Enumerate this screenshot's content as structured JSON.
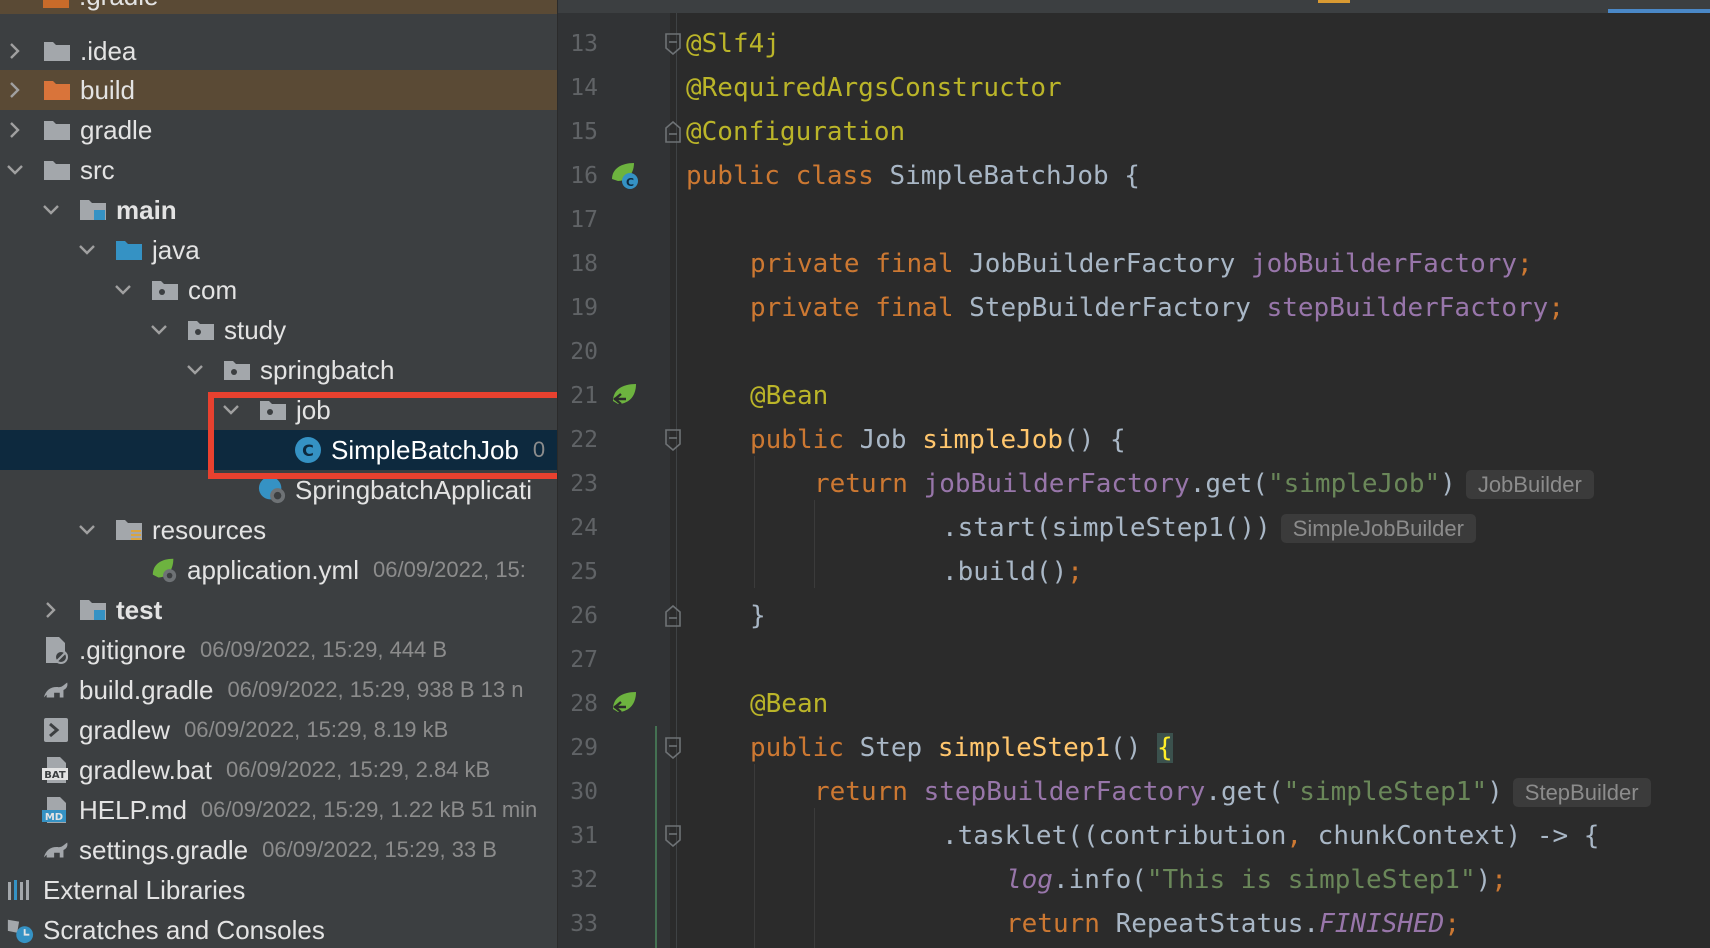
{
  "project_tree": {
    "top_partial": ".gradle",
    "rows": [
      {
        "label": ".idea",
        "meta": "",
        "icon": "folder-icon"
      },
      {
        "label": "build",
        "meta": "",
        "icon": "folder-orange-icon"
      },
      {
        "label": "gradle",
        "meta": "",
        "icon": "folder-icon"
      },
      {
        "label": "src",
        "meta": "",
        "icon": "folder-icon"
      },
      {
        "label": "main",
        "meta": "",
        "icon": "source-root-folder-icon"
      },
      {
        "label": "java",
        "meta": "",
        "icon": "java-source-folder-icon"
      },
      {
        "label": "com",
        "meta": "",
        "icon": "package-icon"
      },
      {
        "label": "study",
        "meta": "",
        "icon": "package-icon"
      },
      {
        "label": "springbatch",
        "meta": "",
        "icon": "package-icon"
      },
      {
        "label": "job",
        "meta": "",
        "icon": "package-icon"
      },
      {
        "label": "SimpleBatchJob",
        "meta": "0",
        "icon": "java-class-icon"
      },
      {
        "label": "SpringbatchApplicati",
        "meta": "",
        "icon": "spring-boot-class-icon"
      },
      {
        "label": "resources",
        "meta": "",
        "icon": "resources-folder-icon"
      },
      {
        "label": "application.yml",
        "meta": "06/09/2022, 15:",
        "icon": "spring-yml-icon"
      },
      {
        "label": "test",
        "meta": "",
        "icon": "test-folder-icon"
      },
      {
        "label": ".gitignore",
        "meta": "06/09/2022, 15:29, 444 B",
        "icon": "gitignore-file-icon"
      },
      {
        "label": "build.gradle",
        "meta": "06/09/2022, 15:29, 938 B 13 n",
        "icon": "gradle-file-icon"
      },
      {
        "label": "gradlew",
        "meta": "06/09/2022, 15:29, 8.19 kB",
        "icon": "shell-script-icon"
      },
      {
        "label": "gradlew.bat",
        "meta": "06/09/2022, 15:29, 2.84 kB",
        "icon": "bat-file-icon"
      },
      {
        "label": "HELP.md",
        "meta": "06/09/2022, 15:29, 1.22 kB 51 min",
        "icon": "markdown-file-icon"
      },
      {
        "label": "settings.gradle",
        "meta": "06/09/2022, 15:29, 33 B",
        "icon": "gradle-file-icon"
      },
      {
        "label": "External Libraries",
        "meta": "",
        "icon": "libraries-icon"
      },
      {
        "label": "Scratches and Consoles",
        "meta": "",
        "icon": "scratches-icon"
      }
    ]
  },
  "editor": {
    "line_numbers": [
      "13",
      "14",
      "15",
      "16",
      "17",
      "18",
      "19",
      "20",
      "21",
      "22",
      "23",
      "24",
      "25",
      "26",
      "27",
      "28",
      "29",
      "30",
      "31",
      "32",
      "33"
    ],
    "lines": {
      "l13": {
        "ann": "@Slf4j"
      },
      "l14": {
        "ann": "@RequiredArgsConstructor"
      },
      "l15": {
        "ann": "@Configuration"
      },
      "l16": {
        "kw": "public class ",
        "name": "SimpleBatchJob",
        "rest": " {"
      },
      "l18": {
        "kw": "private final ",
        "type": "JobBuilderFactory ",
        "field": "jobBuilderFactory",
        "punc": ";"
      },
      "l19": {
        "kw": "private final ",
        "type": "StepBuilderFactory ",
        "field": "stepBuilderFactory",
        "punc": ";"
      },
      "l21": {
        "ann": "@Bean"
      },
      "l22": {
        "kw": "public ",
        "type": "Job ",
        "fn": "simpleJob",
        "rest": "() {"
      },
      "l23": {
        "kw": "return ",
        "field": "jobBuilderFactory",
        "rest": ".get(",
        "str": "\"simpleJob\"",
        "close": ")",
        "hint": "JobBuilder"
      },
      "l24": {
        "rest": ".start(simpleStep1())",
        "hint": "SimpleJobBuilder"
      },
      "l25": {
        "rest": ".build()",
        "punc": ";"
      },
      "l26": {
        "rest": "}"
      },
      "l28": {
        "ann": "@Bean"
      },
      "l29": {
        "kw": "public ",
        "type": "Step ",
        "fn": "simpleStep1",
        "rest": "() ",
        "brace": "{"
      },
      "l30": {
        "kw": "return ",
        "field": "stepBuilderFactory",
        "rest": ".get(",
        "str": "\"simpleStep1\"",
        "close": ")",
        "hint": "StepBuilder"
      },
      "l31": {
        "rest": ".tasklet((contribution",
        "punc": ",",
        "rest2": " chunkContext) -> {"
      },
      "l32": {
        "log": "log",
        "rest": ".info(",
        "str": "\"This is simpleStep1\"",
        "close": ")",
        "punc": ";"
      },
      "l33": {
        "kw": "return ",
        "type": "RepeatStatus.",
        "const": "FINISHED",
        "punc": ";"
      }
    }
  },
  "colors": {
    "tree_bg": "#3c3f41",
    "editor_bg": "#2b2b2b",
    "selection": "#0d293e",
    "highlight_box": "#e8412f",
    "excluded_folder_bg": "#5a4a35"
  }
}
